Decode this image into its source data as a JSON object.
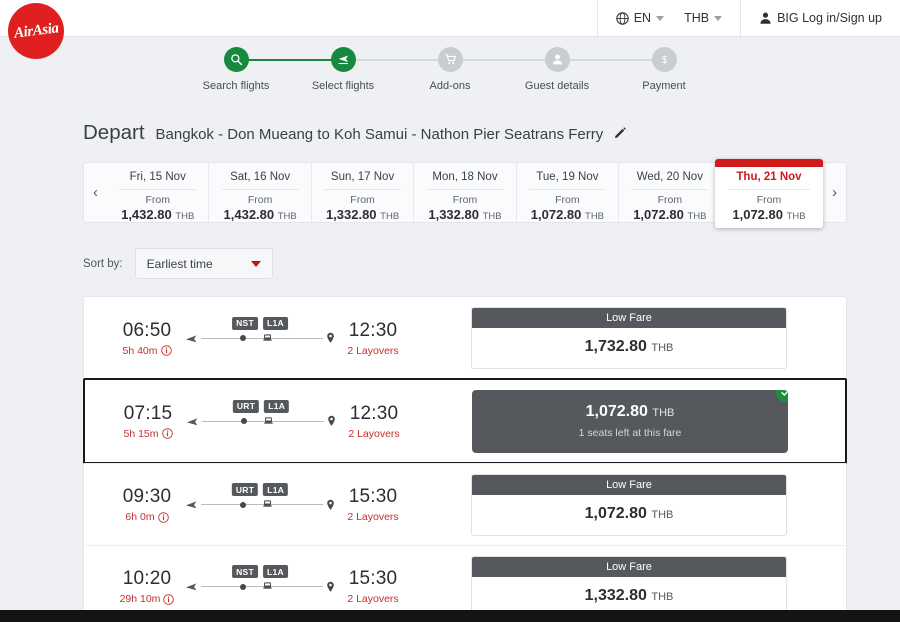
{
  "header": {
    "logo_alt": "AirAsia",
    "language": "EN",
    "currency": "THB",
    "account_label": "BIG Log in/Sign up"
  },
  "stepper": {
    "steps": [
      {
        "label": "Search flights",
        "icon": "search-icon",
        "state": "done"
      },
      {
        "label": "Select flights",
        "icon": "flight-icon",
        "state": "done"
      },
      {
        "label": "Add-ons",
        "icon": "cart-icon",
        "state": "pending"
      },
      {
        "label": "Guest details",
        "icon": "person-icon",
        "state": "pending"
      },
      {
        "label": "Payment",
        "icon": "dollar-icon",
        "state": "pending"
      }
    ]
  },
  "depart": {
    "title": "Depart",
    "route": "Bangkok - Don Mueang to Koh Samui - Nathon Pier Seatrans Ferry",
    "edit_icon": "pencil-icon"
  },
  "date_strip": {
    "prev_label": "‹",
    "next_label": "›",
    "from_label": "From",
    "currency": "THB",
    "dates": [
      {
        "day": "Fri, 15 Nov",
        "price": "1,432.80",
        "selected": false
      },
      {
        "day": "Sat, 16 Nov",
        "price": "1,432.80",
        "selected": false
      },
      {
        "day": "Sun, 17 Nov",
        "price": "1,332.80",
        "selected": false
      },
      {
        "day": "Mon, 18 Nov",
        "price": "1,332.80",
        "selected": false
      },
      {
        "day": "Tue, 19 Nov",
        "price": "1,072.80",
        "selected": false
      },
      {
        "day": "Wed, 20 Nov",
        "price": "1,072.80",
        "selected": false
      },
      {
        "day": "Thu, 21 Nov",
        "price": "1,072.80",
        "selected": true
      }
    ]
  },
  "sort": {
    "label": "Sort by:",
    "value": "Earliest time"
  },
  "flights": [
    {
      "depart_time": "06:50",
      "duration": "5h 40m",
      "arrive_time": "12:30",
      "layovers": "2 Layovers",
      "badges": [
        "NST",
        "L1A"
      ],
      "fare_title": "Low Fare",
      "price": "1,732.80",
      "currency": "THB",
      "selected": false,
      "seats_note": ""
    },
    {
      "depart_time": "07:15",
      "duration": "5h 15m",
      "arrive_time": "12:30",
      "layovers": "2 Layovers",
      "badges": [
        "URT",
        "L1A"
      ],
      "fare_title": "",
      "price": "1,072.80",
      "currency": "THB",
      "selected": true,
      "seats_note": "1 seats left at this fare"
    },
    {
      "depart_time": "09:30",
      "duration": "6h 0m",
      "arrive_time": "15:30",
      "layovers": "2 Layovers",
      "badges": [
        "URT",
        "L1A"
      ],
      "fare_title": "Low Fare",
      "price": "1,072.80",
      "currency": "THB",
      "selected": false,
      "seats_note": ""
    },
    {
      "depart_time": "10:20",
      "duration": "29h 10m",
      "arrive_time": "15:30",
      "layovers": "2 Layovers",
      "badges": [
        "NST",
        "L1A"
      ],
      "fare_title": "Low Fare",
      "price": "1,332.80",
      "currency": "THB",
      "selected": false,
      "seats_note": ""
    }
  ],
  "colors": {
    "brand_red": "#e02020",
    "selected_red": "#d01a1a",
    "step_green": "#16893f",
    "check_green": "#1e8e3e",
    "fare_gray": "#55585c",
    "duration_red": "#c2302c"
  }
}
